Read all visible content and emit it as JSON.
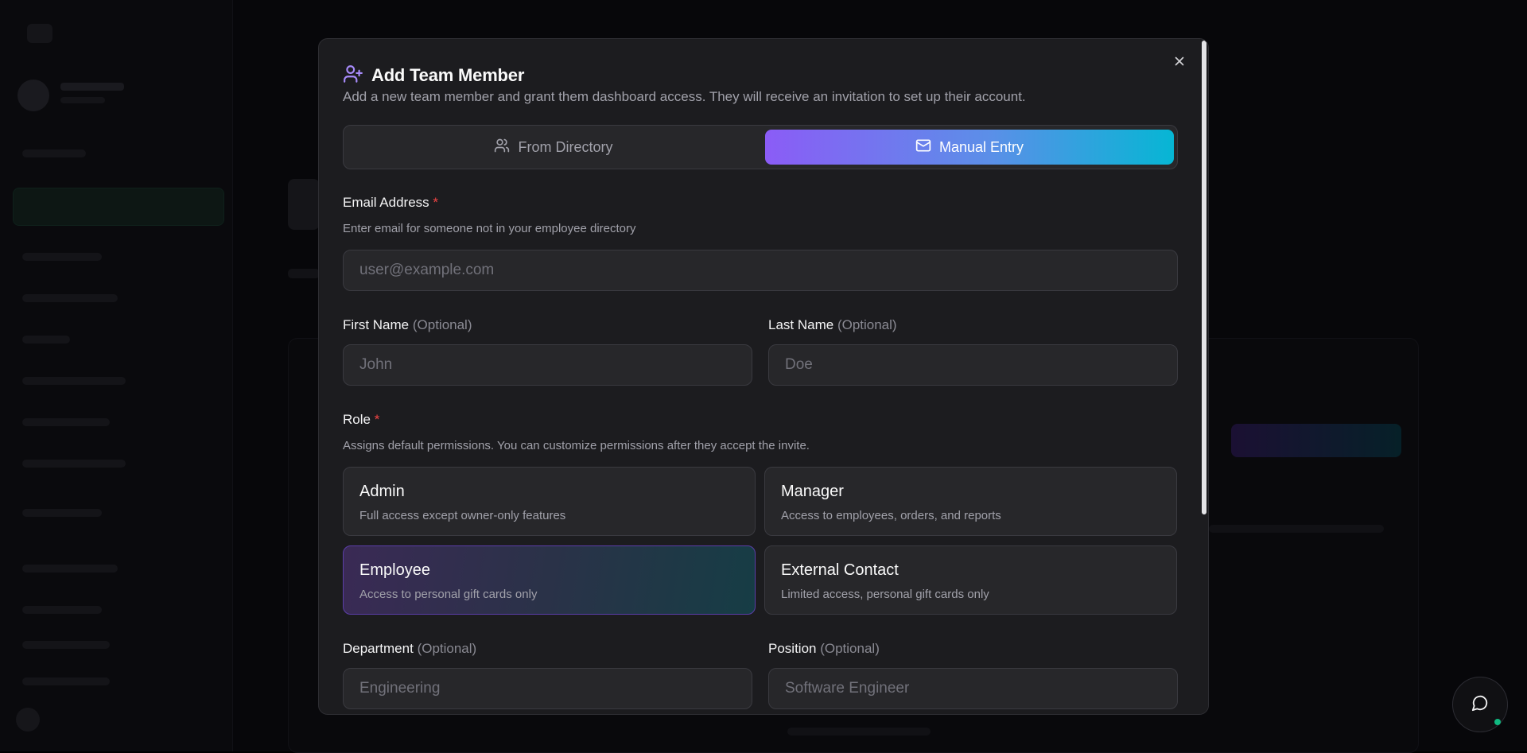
{
  "modal": {
    "title": "Add Team Member",
    "description": "Add a new team member and grant them dashboard access. They will receive an invitation to set up their account.",
    "tabs": [
      {
        "label": "From Directory",
        "icon": "users-icon",
        "active": false
      },
      {
        "label": "Manual Entry",
        "icon": "mail-icon",
        "active": true
      }
    ],
    "email": {
      "label": "Email Address",
      "required_mark": "*",
      "helper": "Enter email for someone not in your employee directory",
      "placeholder": "user@example.com",
      "value": ""
    },
    "first_name": {
      "label": "First Name",
      "optional": "(Optional)",
      "placeholder": "John",
      "value": ""
    },
    "last_name": {
      "label": "Last Name",
      "optional": "(Optional)",
      "placeholder": "Doe",
      "value": ""
    },
    "role": {
      "label": "Role",
      "required_mark": "*",
      "helper": "Assigns default permissions. You can customize permissions after they accept the invite.",
      "options": [
        {
          "name": "Admin",
          "description": "Full access except owner-only features",
          "selected": false
        },
        {
          "name": "Manager",
          "description": "Access to employees, orders, and reports",
          "selected": false
        },
        {
          "name": "Employee",
          "description": "Access to personal gift cards only",
          "selected": true
        },
        {
          "name": "External Contact",
          "description": "Limited access, personal gift cards only",
          "selected": false
        }
      ]
    },
    "department": {
      "label": "Department",
      "optional": "(Optional)",
      "placeholder": "Engineering",
      "value": ""
    },
    "position": {
      "label": "Position",
      "optional": "(Optional)",
      "placeholder": "Software Engineer",
      "value": ""
    }
  },
  "colors": {
    "accent_purple": "#8b5cf6",
    "accent_cyan": "#06b6d4",
    "required": "#ef4444",
    "online_status": "#10b981"
  }
}
